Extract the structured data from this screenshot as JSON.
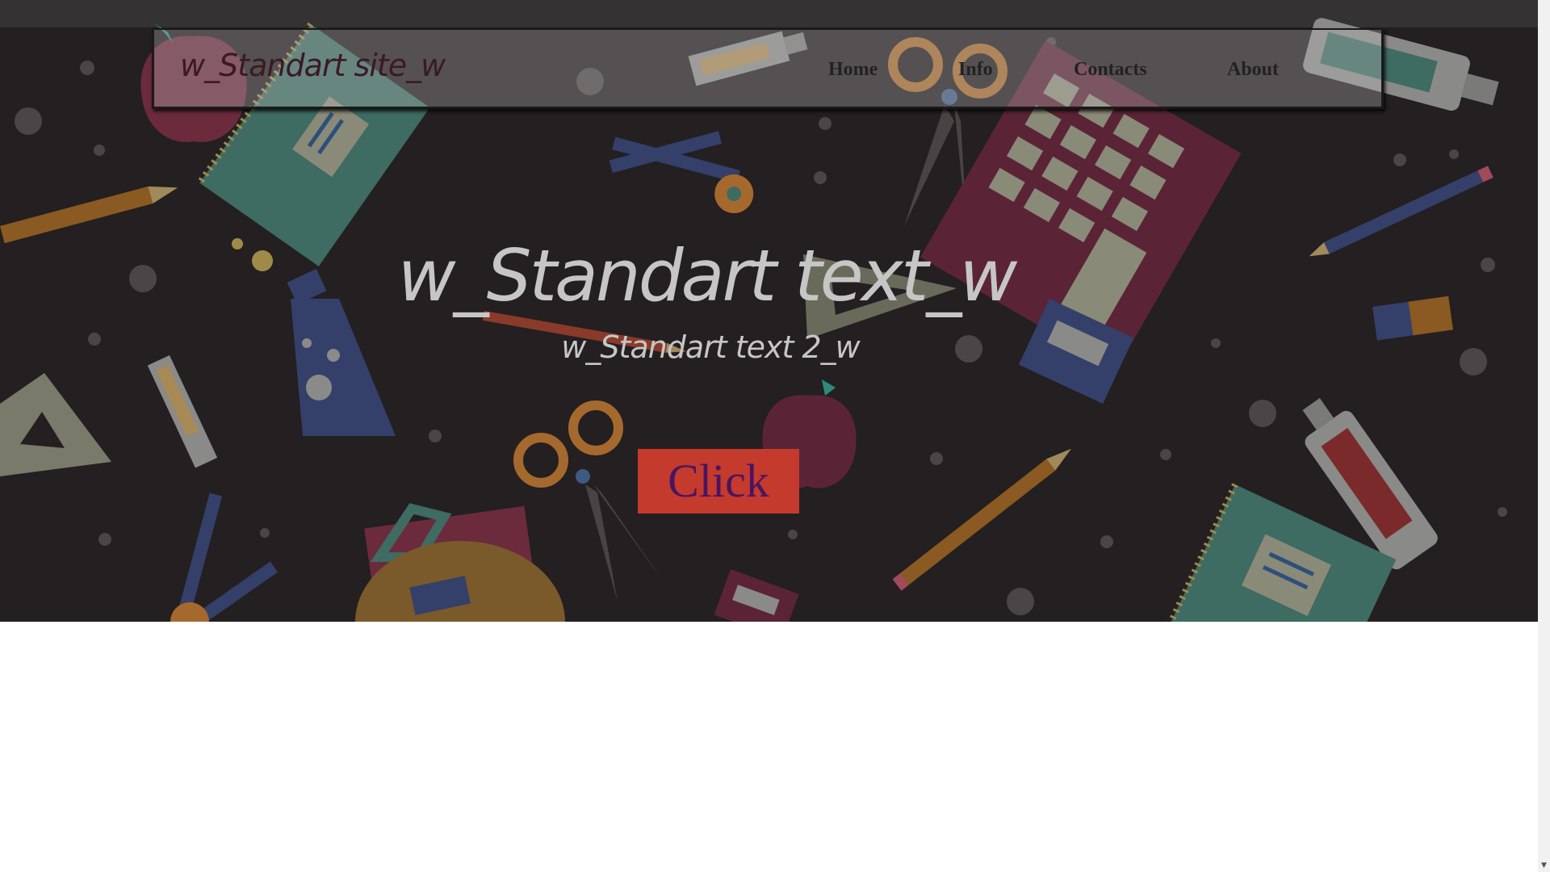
{
  "site": {
    "logo_text": "w_Standart site_w"
  },
  "nav": {
    "items": [
      {
        "label": "Home"
      },
      {
        "label": "Info"
      },
      {
        "label": "Contacts"
      },
      {
        "label": "About"
      }
    ]
  },
  "hero": {
    "title": "w_Standart text_w",
    "subtitle": "w_Standart text 2_w",
    "cta_label": "Click"
  },
  "colors": {
    "hero_background": "#241f20",
    "cta_background": "#c43a2c",
    "cta_text": "#4a1560",
    "logo_text": "#3a1a24"
  },
  "scrollbar": {
    "down_arrow_icon": "chevron-down-icon"
  }
}
